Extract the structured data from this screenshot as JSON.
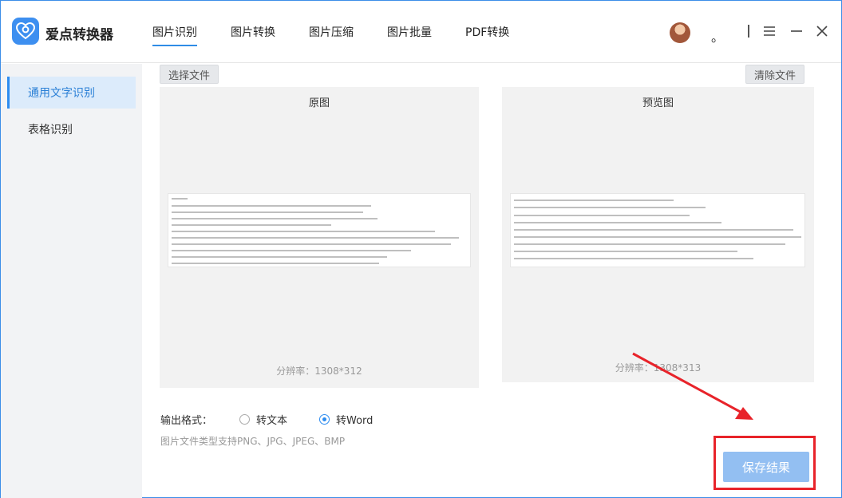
{
  "app": {
    "title": "爱点转换器"
  },
  "tabs": [
    {
      "label": "图片识别"
    },
    {
      "label": "图片转换"
    },
    {
      "label": "图片压缩"
    },
    {
      "label": "图片批量"
    },
    {
      "label": "PDF转换"
    }
  ],
  "header": {
    "dot": "。"
  },
  "sidebar": {
    "items": [
      {
        "label": "通用文字识别"
      },
      {
        "label": "表格识别"
      }
    ]
  },
  "toolbar": {
    "select_file": "选择文件",
    "clear_file": "清除文件"
  },
  "original": {
    "title": "原图",
    "resolution": "分辨率：1308*312"
  },
  "preview": {
    "title": "预览图",
    "resolution": "分辨率：1308*313"
  },
  "output": {
    "label": "输出格式：",
    "options": [
      {
        "label": "转文本",
        "selected": false
      },
      {
        "label": "转Word",
        "selected": true
      }
    ],
    "hint": "图片文件类型支持PNG、JPG、JPEG、BMP"
  },
  "save_button": {
    "label": "保存结果"
  },
  "colors": {
    "accent": "#2d8cf0",
    "highlight": "#e8232a",
    "logo": "#3d8ff0"
  }
}
